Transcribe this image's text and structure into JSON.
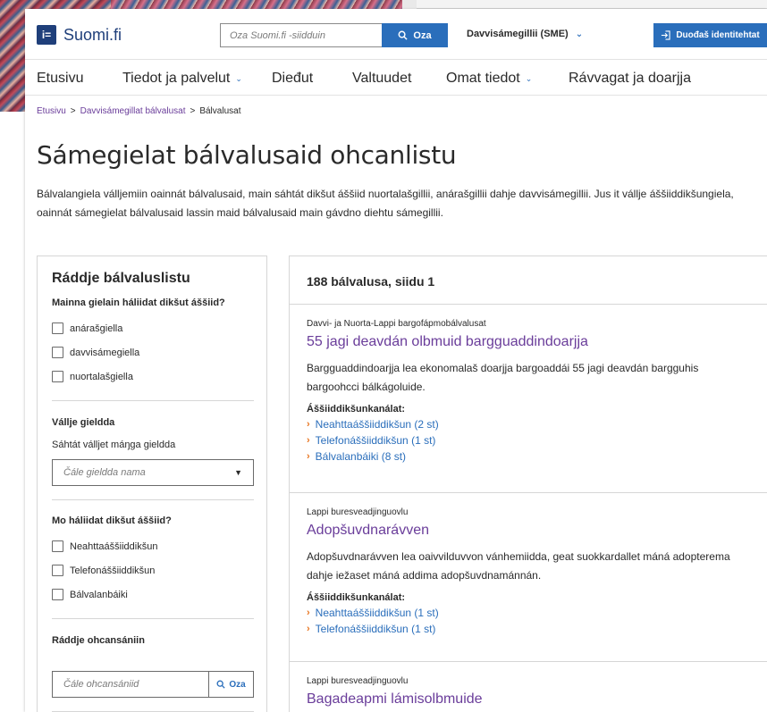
{
  "header": {
    "logo_mark": "i=",
    "logo_text": "Suomi.fi",
    "search_placeholder": "Oza Suomi.fi -siidduin",
    "search_button": "Oza",
    "language": "Davvisámegillii (SME)",
    "identify_button": "Duođaš identitehtat"
  },
  "nav": {
    "items": [
      {
        "label": "Etusivu"
      },
      {
        "label": "Tiedot ja palvelut"
      },
      {
        "label": "Dieđut"
      },
      {
        "label": "Valtuudet"
      },
      {
        "label": "Omat tiedot"
      },
      {
        "label": "Rávvagat ja doarjja"
      }
    ]
  },
  "breadcrumb": {
    "items": [
      "Etusivu",
      "Davvisámegillat bálvalusat",
      "Bálvalusat"
    ],
    "separator": ">"
  },
  "page": {
    "title": "Sámegielat bálvalusaid ohcanlistu",
    "intro": "Bálvalangiela válljemiin oainnát bálvalusaid, main sáhtát dikšut áššiid nuortalašgillii, anárašgillii dahje davvisámegillii. Jus it vállje áššiiddikšungiela, oainnát sámegielat bálvalusaid lassin maid bálvalusaid main gávdno diehtu sámegillii."
  },
  "filter": {
    "title": "Ráddje bálvaluslistu",
    "language_question": "Mainna gielain háliidat dikšut áššiid?",
    "languages": [
      "anárašgiella",
      "davvisámegiella",
      "nuortalašgiella"
    ],
    "municipality_label": "Vállje gieldda",
    "municipality_hint": "Sáhtát válljet máŋga gieldda",
    "municipality_placeholder": "Čále gieldda nama",
    "channel_question": "Mo háliidat dikšut áššiid?",
    "channels": [
      "Neahttaáššiiddikšun",
      "Telefonáššiiddikšun",
      "Bálvalanbáiki"
    ],
    "keyword_label": "Ráddje ohcansániin",
    "keyword_placeholder": "Čále ohcansániid",
    "keyword_button": "Oza"
  },
  "results": {
    "summary": "188 bálvalusa, siidu 1",
    "channels_label": "Áššiiddikšunkanálat:",
    "items": [
      {
        "org": "Davvi- ja Nuorta-Lappi bargofápmobálvalusat",
        "title": "55 jagi deavdán olbmuid bargguaddindoarjja",
        "desc": "Bargguaddindoarjja lea ekonomalaš doarjja bargoaddái 55 jagi deavdán bargguhis bargoohcci bálkágoluide.",
        "channels": [
          "Neahttaáššiiddikšun (2 st)",
          "Telefonáššiiddikšun (1 st)",
          "Bálvalanbáiki (8 st)"
        ]
      },
      {
        "org": "Lappi buresveadjinguovlu",
        "title": "Adopšuvdnarávven",
        "desc": "Adopšuvdnarávven lea oaivvilduvvon vánhemiidda, geat suokkardallet máná adopterema dahje iežaset máná addima adopšuvdnamánnán.",
        "channels": [
          "Neahttaáššiiddikšun (1 st)",
          "Telefonáššiiddikšun (1 st)"
        ]
      },
      {
        "org": "Lappi buresveadjinguovlu",
        "title": "Bagadeapmi lámisolbmuide",
        "desc": "",
        "channels": []
      }
    ]
  },
  "colors": {
    "brand": "#1f3f7a",
    "primary": "#2a6ebb",
    "link_visited": "#6a3d9a",
    "chevron_accent": "#e8741e"
  }
}
